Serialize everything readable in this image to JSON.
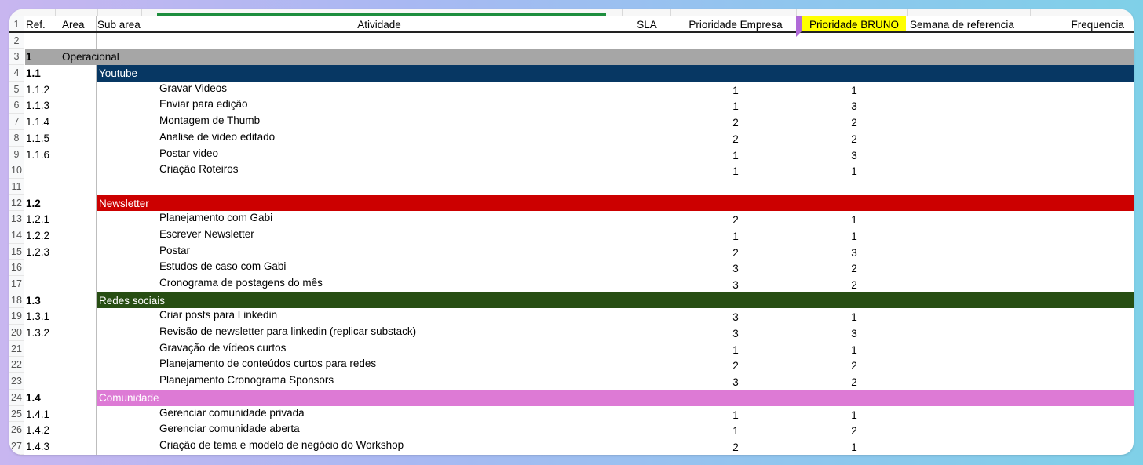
{
  "headers": {
    "row_num": "1",
    "ref": "Ref.",
    "area": "Area",
    "sub_area": "Sub area",
    "atividade": "Atividade",
    "sla": "SLA",
    "prioridade_empresa": "Prioridade Empresa",
    "prioridade_bruno": "Prioridade BRUNO",
    "semana": "Semana de referencia",
    "frequencia": "Frequencia"
  },
  "colors": {
    "youtube": "#073763",
    "newsletter": "#cc0000",
    "redes": "#274e13",
    "comunidade": "#dd7ad5",
    "gray": "#a6a6a6",
    "highlight": "#ffff00"
  },
  "rows": [
    {
      "n": "2",
      "type": "empty"
    },
    {
      "n": "3",
      "type": "section",
      "ref": "1",
      "area": "Operacional"
    },
    {
      "n": "4",
      "type": "group",
      "ref": "1.1",
      "label": "Youtube",
      "color": "youtube"
    },
    {
      "n": "5",
      "type": "item",
      "ref": "1.1.2",
      "ativ": "Gravar Videos",
      "emp": "1",
      "bru": "1"
    },
    {
      "n": "6",
      "type": "item",
      "ref": "1.1.3",
      "ativ": "Enviar para edição",
      "emp": "1",
      "bru": "3"
    },
    {
      "n": "7",
      "type": "item",
      "ref": "1.1.4",
      "ativ": "Montagem de Thumb",
      "emp": "2",
      "bru": "2"
    },
    {
      "n": "8",
      "type": "item",
      "ref": "1.1.5",
      "ativ": "Analise de video editado",
      "emp": "2",
      "bru": "2"
    },
    {
      "n": "9",
      "type": "item",
      "ref": "1.1.6",
      "ativ": "Postar video",
      "emp": "1",
      "bru": "3"
    },
    {
      "n": "10",
      "type": "item",
      "ref": "",
      "ativ": "Criação Roteiros",
      "emp": "1",
      "bru": "1"
    },
    {
      "n": "11",
      "type": "empty"
    },
    {
      "n": "12",
      "type": "group",
      "ref": "1.2",
      "label": "Newsletter",
      "color": "newsletter"
    },
    {
      "n": "13",
      "type": "item",
      "ref": "1.2.1",
      "ativ": "Planejamento com Gabi",
      "emp": "2",
      "bru": "1"
    },
    {
      "n": "14",
      "type": "item",
      "ref": "1.2.2",
      "ativ": "Escrever Newsletter",
      "emp": "1",
      "bru": "1"
    },
    {
      "n": "15",
      "type": "item",
      "ref": "1.2.3",
      "ativ": "Postar",
      "emp": "2",
      "bru": "3"
    },
    {
      "n": "16",
      "type": "item",
      "ref": "",
      "ativ": "Estudos de caso com Gabi",
      "emp": "3",
      "bru": "2"
    },
    {
      "n": "17",
      "type": "item",
      "ref": "",
      "ativ": "Cronograma de postagens do mês",
      "emp": "3",
      "bru": "2"
    },
    {
      "n": "18",
      "type": "group",
      "ref": "1.3",
      "label": "Redes sociais",
      "color": "redes"
    },
    {
      "n": "19",
      "type": "item",
      "ref": "1.3.1",
      "ativ": "Criar posts para Linkedin",
      "emp": "3",
      "bru": "1"
    },
    {
      "n": "20",
      "type": "item",
      "ref": "1.3.2",
      "ativ": "Revisão de newsletter para linkedin (replicar substack)",
      "emp": "3",
      "bru": "3"
    },
    {
      "n": "21",
      "type": "item",
      "ref": "",
      "ativ": "Gravação de vídeos curtos",
      "emp": "1",
      "bru": "1"
    },
    {
      "n": "22",
      "type": "item",
      "ref": "",
      "ativ": "Planejamento de conteúdos curtos para redes",
      "emp": "2",
      "bru": "2"
    },
    {
      "n": "23",
      "type": "item",
      "ref": "",
      "ativ": "Planejamento Cronograma Sponsors",
      "emp": "3",
      "bru": "2"
    },
    {
      "n": "24",
      "type": "group",
      "ref": "1.4",
      "label": "Comunidade",
      "color": "comunidade"
    },
    {
      "n": "25",
      "type": "item",
      "ref": "1.4.1",
      "ativ": "Gerenciar comunidade privada",
      "emp": "1",
      "bru": "1"
    },
    {
      "n": "26",
      "type": "item",
      "ref": "1.4.2",
      "ativ": "Gerenciar comunidade aberta",
      "emp": "1",
      "bru": "2"
    },
    {
      "n": "27",
      "type": "item",
      "ref": "1.4.3",
      "ativ": "Criação de tema e modelo de negócio do Workshop",
      "emp": "2",
      "bru": "1"
    }
  ]
}
